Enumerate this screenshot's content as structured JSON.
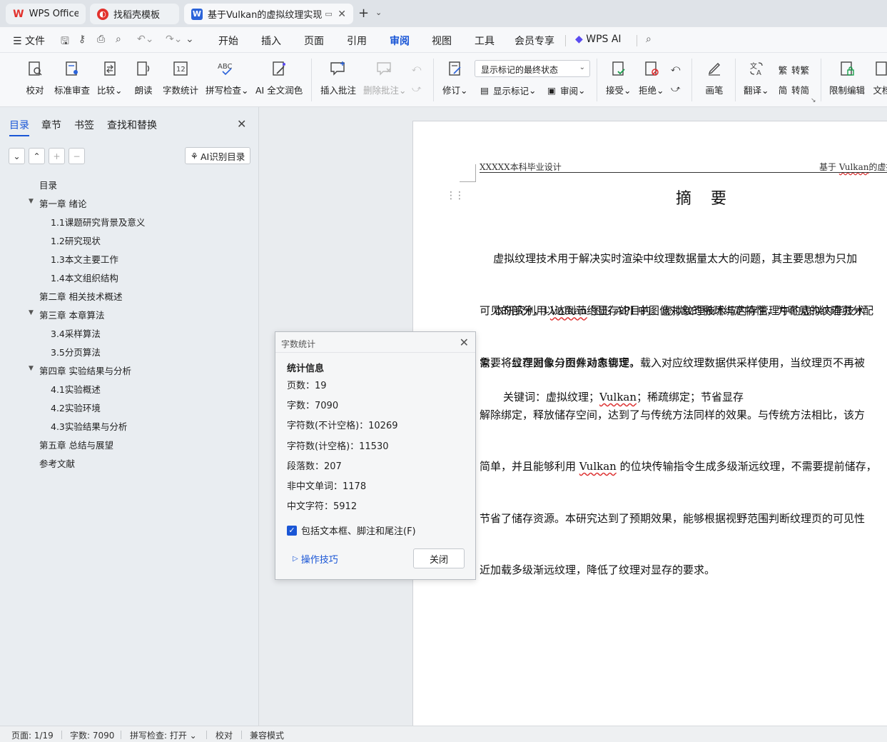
{
  "tabs": [
    {
      "label": "WPS Office",
      "icon": "wps-logo-icon"
    },
    {
      "label": "找稻壳模板",
      "icon": "docer-icon"
    },
    {
      "label": "基于Vulkan的虚拟纹理实现",
      "icon": "word-doc-icon"
    }
  ],
  "menubar": {
    "file": "文件",
    "items": [
      "开始",
      "插入",
      "页面",
      "引用",
      "审阅",
      "视图",
      "工具",
      "会员专享"
    ],
    "active": "审阅",
    "ai": "WPS AI"
  },
  "ribbon": {
    "proofread": "校对",
    "standard_review": "标准审查",
    "compare": "比较",
    "read_aloud": "朗读",
    "word_count": "字数统计",
    "spell_check": "拼写检查",
    "ai_polish": "AI 全文润色",
    "insert_comment": "插入批注",
    "delete_comment": "删除批注",
    "track_changes": "修订",
    "markup_dropdown": "显示标记的最终状态",
    "show_markup": "显示标记",
    "review_pane": "审阅",
    "accept": "接受",
    "reject": "拒绝",
    "pen": "画笔",
    "translate": "翻译",
    "to_traditional": "转繁",
    "to_simplified": "转简",
    "restrict_edit": "限制编辑",
    "doc_partial": "文档"
  },
  "left_panel": {
    "tabs": [
      "目录",
      "章节",
      "书签",
      "查找和替换"
    ],
    "active_tab": "目录",
    "ai_button": "AI识别目录",
    "toc": [
      {
        "label": "目录",
        "level": 1,
        "arrow": false
      },
      {
        "label": "第一章 绪论",
        "level": 1,
        "arrow": true
      },
      {
        "label": "1.1课题研究背景及意义",
        "level": 2,
        "arrow": false
      },
      {
        "label": "1.2研究现状",
        "level": 2,
        "arrow": false
      },
      {
        "label": "1.3本文主要工作",
        "level": 2,
        "arrow": false
      },
      {
        "label": "1.4本文组织结构",
        "level": 2,
        "arrow": false
      },
      {
        "label": "第二章 相关技术概述",
        "level": 1,
        "arrow": false
      },
      {
        "label": "第三章 本章算法",
        "level": 1,
        "arrow": true
      },
      {
        "label": "3.4采样算法",
        "level": 2,
        "arrow": false
      },
      {
        "label": "3.5分页算法",
        "level": 2,
        "arrow": false
      },
      {
        "label": "第四章 实验结果与分析",
        "level": 1,
        "arrow": true
      },
      {
        "label": "4.1实验概述",
        "level": 2,
        "arrow": false
      },
      {
        "label": "4.2实验环境",
        "level": 2,
        "arrow": false
      },
      {
        "label": "4.3实验结果与分析",
        "level": 2,
        "arrow": false
      },
      {
        "label": "第五章 总结与展望",
        "level": 1,
        "arrow": false
      },
      {
        "label": "参考文献",
        "level": 1,
        "arrow": false
      }
    ]
  },
  "document": {
    "header_left": "XXXXX本科毕业设计",
    "header_right": "基于 Vulkan的虚拟",
    "title": "摘  要",
    "paragraph1": [
      "    虚拟纹理技术用于解决实时渲染中纹理数据量太大的问题，其主要思想为只加",
      "可见的部分，以达到节约显存的目的。虚拟纹理技术与内存管理中的虚拟内存技术",
      "需要将纹理图像分页并动态管理。"
    ],
    "paragraph2": [
      "    本研究利用 Vulkan 图形 API 中图像对象的稀疏绑定特性，为可见的纹理页分配",
      "象，将显存对象与图像对象绑定，载入对应纹理数据供采样使用，当纹理页不再被",
      "解除绑定，释放储存空间，达到了与传统方法同样的效果。与传统方法相比，该方",
      "简单，并且能够利用 Vulkan 的位块传输指令生成多级渐远纹理，不需要提前储存，",
      "节省了储存资源。本研究达到了预期效果，能够根据视野范围判断纹理页的可见性",
      "近加载多级渐远纹理，降低了纹理对显存的要求。"
    ],
    "keywords": "关键词：虚拟纹理；Vulkan；稀疏绑定；节省显存"
  },
  "dialog": {
    "title": "字数统计",
    "section": "统计信息",
    "stats": [
      "页数：19",
      "字数：7090",
      "字符数(不计空格)：10269",
      "字符数(计空格)：11530",
      "段落数：207",
      "非中文单词：1178",
      "中文字符：5912"
    ],
    "checkbox_label": "包括文本框、脚注和尾注(F)",
    "checkbox_checked": true,
    "tips": "操作技巧",
    "close": "关闭"
  },
  "statusbar": {
    "page": "页面: 1/19",
    "words": "字数: 7090",
    "spell": "拼写检查: 打开",
    "proof": "校对",
    "compat": "兼容模式"
  },
  "colors": {
    "accent": "#1a56d6",
    "wps_red": "#e2322d"
  }
}
